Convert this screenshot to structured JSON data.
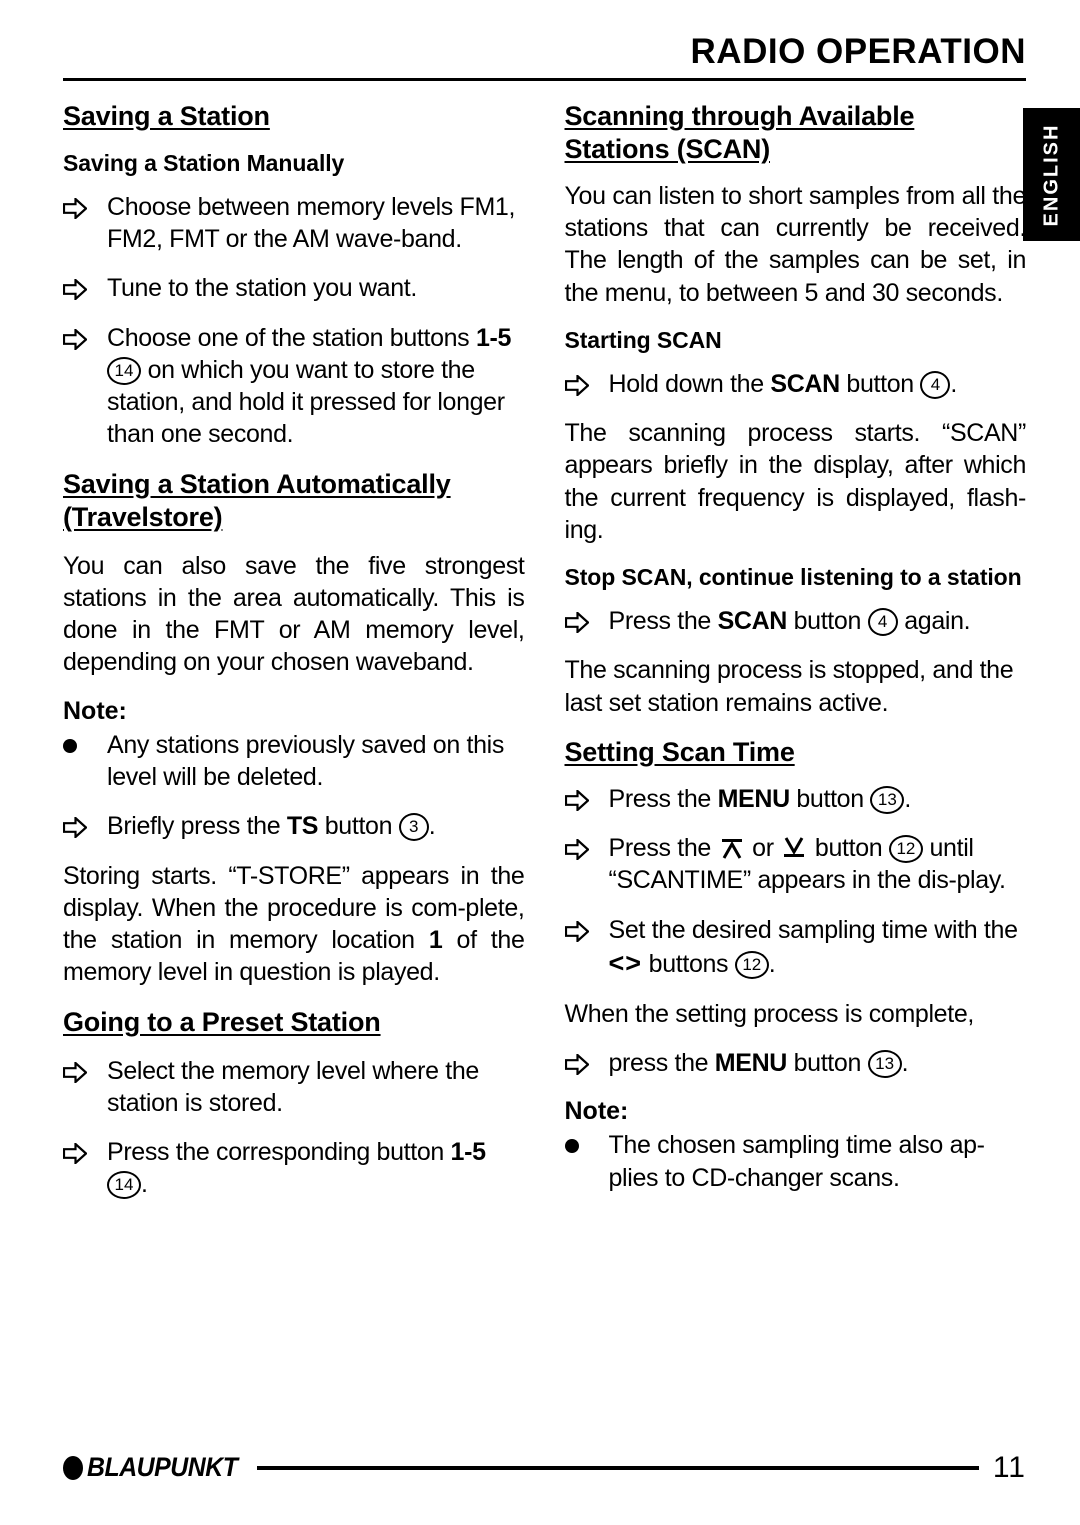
{
  "header": {
    "title": "RADIO OPERATION"
  },
  "side_tab": {
    "label": "ENGLISH"
  },
  "left_column": {
    "heading_saving": "Saving a Station",
    "subheading_manual": "Saving a Station Manually",
    "step_choose_levels_a": "Choose between memory levels FM1, FM2, FMT or the AM wave-band.",
    "step_tune": "Tune to the station you want.",
    "step_choose_button_pre": "Choose one of the station buttons ",
    "step_choose_button_bold": "1-5",
    "step_choose_button_ref": "14",
    "step_choose_button_post": " on which you want to store the station, and hold it pressed for longer than one second.",
    "heading_travelstore": "Saving a Station Automatically (Travelstore)",
    "para_travelstore": "You can also save the five strongest stations in the area automatically. This is done in the FMT or AM memory level, depending on your chosen waveband.",
    "note_label": "Note:",
    "note_bullet": "Any stations previously saved on this level will be deleted.",
    "step_ts_pre": "Briefly press the ",
    "step_ts_bold": "TS",
    "step_ts_mid": " button ",
    "step_ts_ref": "3",
    "step_ts_post": ".",
    "para_storing_a": "Storing starts. “T-STORE” appears in the display. When the procedure is com-plete, the station in memory location ",
    "para_storing_bold": "1",
    "para_storing_b": " of the memory level in question is played.",
    "heading_preset": "Going to a Preset Station",
    "step_select_level": "Select the memory level where the station is stored.",
    "step_press_corresponding_pre": "Press the corresponding button ",
    "step_press_corresponding_bold": "1-5",
    "step_press_corresponding_ref": "14",
    "step_press_corresponding_post": "."
  },
  "right_column": {
    "heading_scan": "Scanning through Available Stations (SCAN)",
    "para_scan_intro": "You can listen to short samples from all the stations that can currently be received. The length of the samples can be set, in the menu, to between 5 and 30 seconds.",
    "subheading_starting": "Starting SCAN",
    "step_hold_pre": "Hold down the ",
    "step_hold_bold": "SCAN",
    "step_hold_mid": " button ",
    "step_hold_ref": "4",
    "step_hold_post": ".",
    "para_scan_starts": "The scanning process starts. “SCAN” appears briefly in the display, after which the current frequency is displayed, flash-ing.",
    "subheading_stop": "Stop SCAN, continue listening to a station",
    "step_press_scan_pre": "Press the ",
    "step_press_scan_bold": "SCAN",
    "step_press_scan_mid": " button ",
    "step_press_scan_ref": "4",
    "step_press_scan_post": " again.",
    "para_scan_stopped": "The scanning process is stopped, and the last set station remains active.",
    "heading_scan_time": "Setting Scan Time",
    "step_menu_pre": "Press the ",
    "step_menu_bold": "MENU",
    "step_menu_mid": " button ",
    "step_menu_ref": "13",
    "step_menu_post": ".",
    "step_updown_pre": "Press the ",
    "step_updown_icon_up": "up-bar-arrow",
    "step_updown_or": " or ",
    "step_updown_icon_down": "down-bar-arrow",
    "step_updown_mid": " button ",
    "step_updown_ref": "12",
    "step_updown_post": " until “SCANTIME” appears in the dis-play.",
    "step_sampling_pre": "Set the desired sampling time with the ",
    "step_sampling_symbols": "<>",
    "step_sampling_mid": " buttons ",
    "step_sampling_ref": "12",
    "step_sampling_post": ".",
    "para_when_complete": "When the setting process is complete,",
    "step_press_menu_pre": "press the ",
    "step_press_menu_bold": "MENU",
    "step_press_menu_mid": " button ",
    "step_press_menu_ref": "13",
    "step_press_menu_post": ".",
    "note_label": "Note:",
    "note_bullet": "The chosen sampling time also ap-plies to CD-changer scans."
  },
  "footer": {
    "brand": "BLAUPUNKT",
    "page_number": "11"
  }
}
